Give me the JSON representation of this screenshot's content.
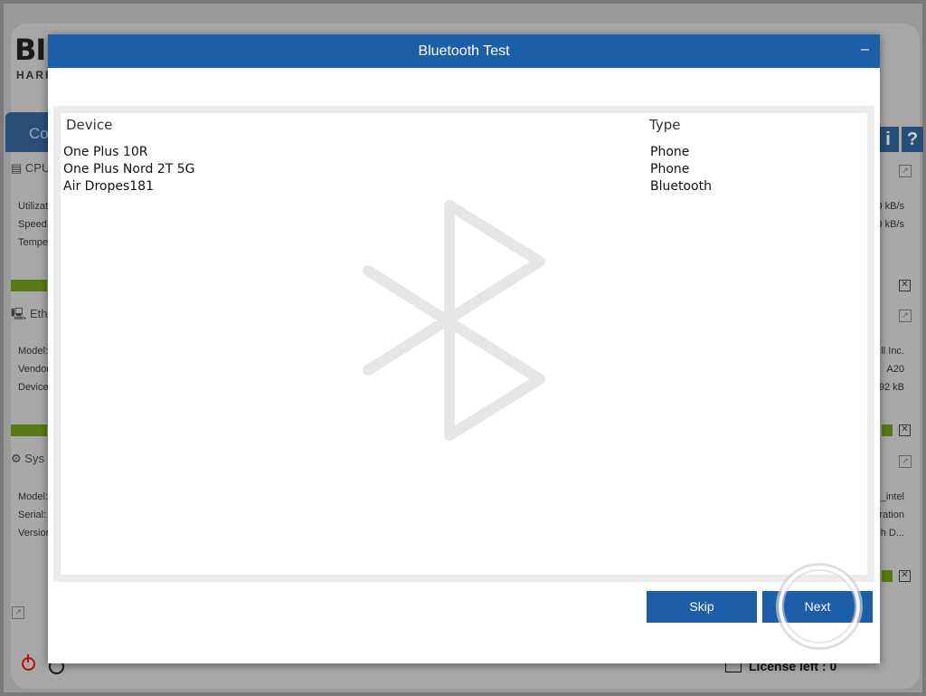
{
  "background_app": {
    "logo_letters": "BI",
    "logo_subtitle": "HARI",
    "tab_label": "Co",
    "right_buttons": [
      "i",
      "?"
    ],
    "cpu_section": {
      "title": "CPU",
      "rows": [
        "Utilizati",
        "Speed:",
        "Tempe"
      ],
      "right_rows": [
        "0 kB/s",
        "0 kB/s"
      ]
    },
    "ethernet_section": {
      "title": "Ethe",
      "rows": [
        "Model:",
        "Vendor",
        "Device"
      ],
      "right_rows": [
        "ll Inc.",
        "A20",
        "92 kB"
      ]
    },
    "system_section": {
      "title": "Sys",
      "rows": [
        "Model:",
        "Serial:",
        "Versior"
      ],
      "right_rows": [
        "_intel",
        "ration",
        "h D..."
      ]
    },
    "license_text": "License left : 0"
  },
  "dialog": {
    "title": "Bluetooth Test",
    "minimize_label": "–",
    "columns": {
      "device": "Device",
      "type": "Type"
    },
    "devices": [
      {
        "name": "One Plus 10R",
        "type": "Phone"
      },
      {
        "name": "One Plus Nord 2T 5G",
        "type": "Phone"
      },
      {
        "name": "Air Dropes181",
        "type": "Bluetooth"
      }
    ],
    "watermark_icon": "bluetooth-icon",
    "buttons": {
      "skip": "Skip",
      "next": "Next"
    }
  },
  "colors": {
    "header_blue": "#1c5ea8",
    "button_blue": "#1c5ea8",
    "watermark_gray": "#e6e6e6"
  }
}
